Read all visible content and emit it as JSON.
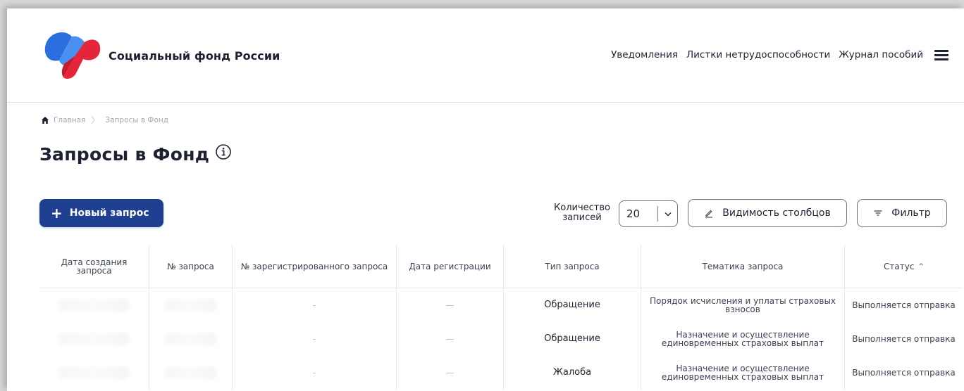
{
  "header": {
    "brand": "Социальный фонд России",
    "nav": [
      "Уведомления",
      "Листки нетрудоспособности",
      "Журнал пособий"
    ],
    "menu_icon": "hamburger-icon",
    "logo_colors": {
      "blue": "#2b6ee0",
      "red": "#e5263a"
    }
  },
  "breadcrumb": {
    "home": "Главная",
    "current": "Запросы в Фонд"
  },
  "page": {
    "title": "Запросы в Фонд",
    "info_icon": "info-icon"
  },
  "toolbar": {
    "new_request": "Новый запрос",
    "count_label": "Количество записей",
    "count_value": "20",
    "columns_visibility": "Видимость столбцов",
    "filter": "Фильтр"
  },
  "table": {
    "columns": [
      "Дата создания запроса",
      "№ запроса",
      "№ зарегистрированного запроса",
      "Дата регистрации",
      "Тип запроса",
      "Тематика запроса",
      "Статус"
    ],
    "sort_indicator": "^",
    "rows": [
      {
        "reg_number": "-",
        "reg_date": "—",
        "type": "Обращение",
        "topic": "Порядок исчисления и уплаты страховых взносов",
        "status": "Выполняется отправка"
      },
      {
        "reg_number": "-",
        "reg_date": "—",
        "type": "Обращение",
        "topic": "Назначение и осуществление единовременных страховых выплат",
        "status": "Выполняется отправка"
      },
      {
        "reg_number": "-",
        "reg_date": "—",
        "type": "Жалоба",
        "topic": "Назначение и осуществление единовременных страховых выплат",
        "status": "Выполняется отправка"
      }
    ]
  },
  "colors": {
    "primary": "#1f3f90",
    "text": "#1d2233",
    "muted": "#a3a9b6"
  }
}
